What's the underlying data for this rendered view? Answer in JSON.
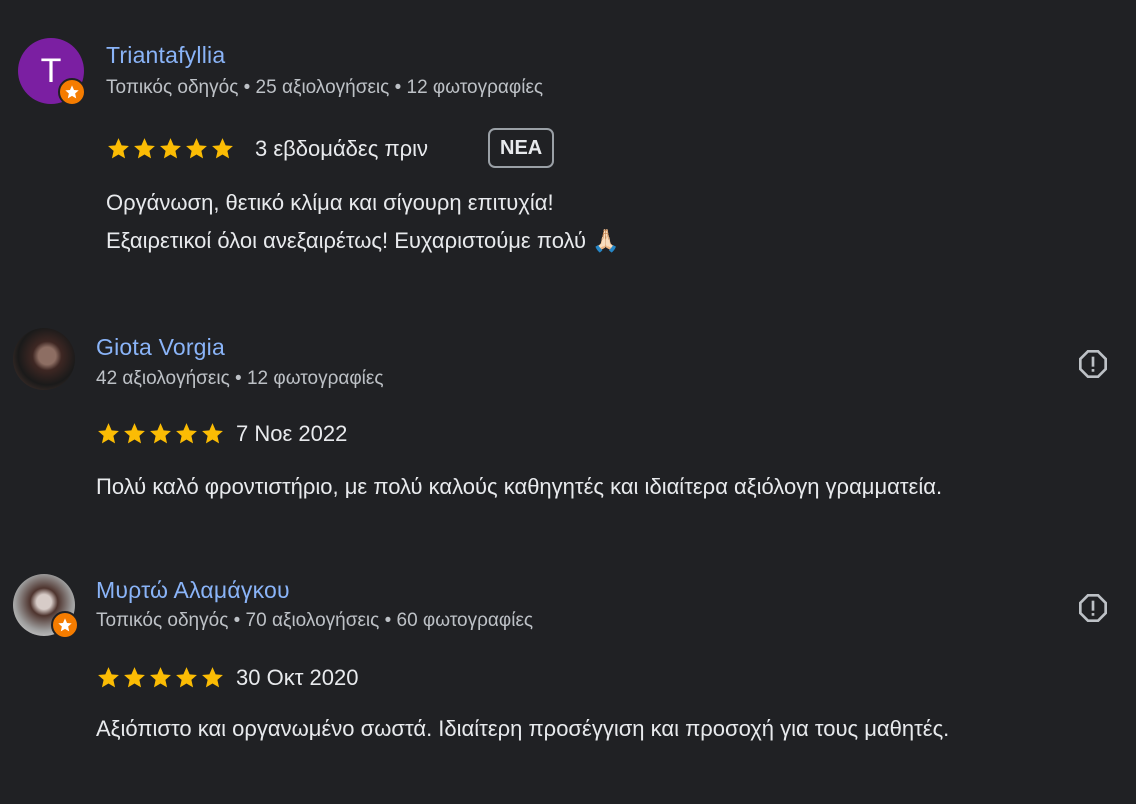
{
  "reviews": [
    {
      "name": "Triantafyllia",
      "avatar_letter": "T",
      "avatar_color": "#7b1fa2",
      "local_guide": true,
      "meta": "Τοπικός οδηγός • 25 αξιολογήσεις • 12 φωτογραφίες",
      "rating": 5,
      "date": "3 εβδομάδες πριν",
      "new_label": "ΝΕΑ",
      "text_line1": "Οργάνωση, θετικό κλίμα και σίγουρη επιτυχία!",
      "text_line2": "Εξαιρετικοί όλοι ανεξαιρέτως! Ευχαριστούμε πολύ 🙏🏻"
    },
    {
      "name": "Giota Vorgia",
      "local_guide": false,
      "meta": "42 αξιολογήσεις • 12 φωτογραφίες",
      "rating": 5,
      "date": "7 Νοε 2022",
      "text_line1": "Πολύ καλό φροντιστήριο, με πολύ καλούς καθηγητές και ιδιαίτερα αξιόλογη γραμματεία."
    },
    {
      "name": "Μυρτώ Αλαμάγκου",
      "local_guide": true,
      "meta": "Τοπικός οδηγός • 70 αξιολογήσεις • 60 φωτογραφίες",
      "rating": 5,
      "date": "30 Οκτ 2020",
      "text_line1": "Αξιόπιστο και οργανωμένο σωστά. Ιδιαίτερη προσέγγιση και προσοχή για τους μαθητές."
    }
  ],
  "colors": {
    "background": "#202124",
    "name": "#8ab4f8",
    "star": "#fbbc04",
    "badge": "#f57c00",
    "text": "#e8eaed",
    "meta": "#bdc1c6"
  },
  "icons": {
    "star": "star-icon",
    "local_guide": "local-guide-star-icon",
    "report": "report-exclamation-icon"
  }
}
